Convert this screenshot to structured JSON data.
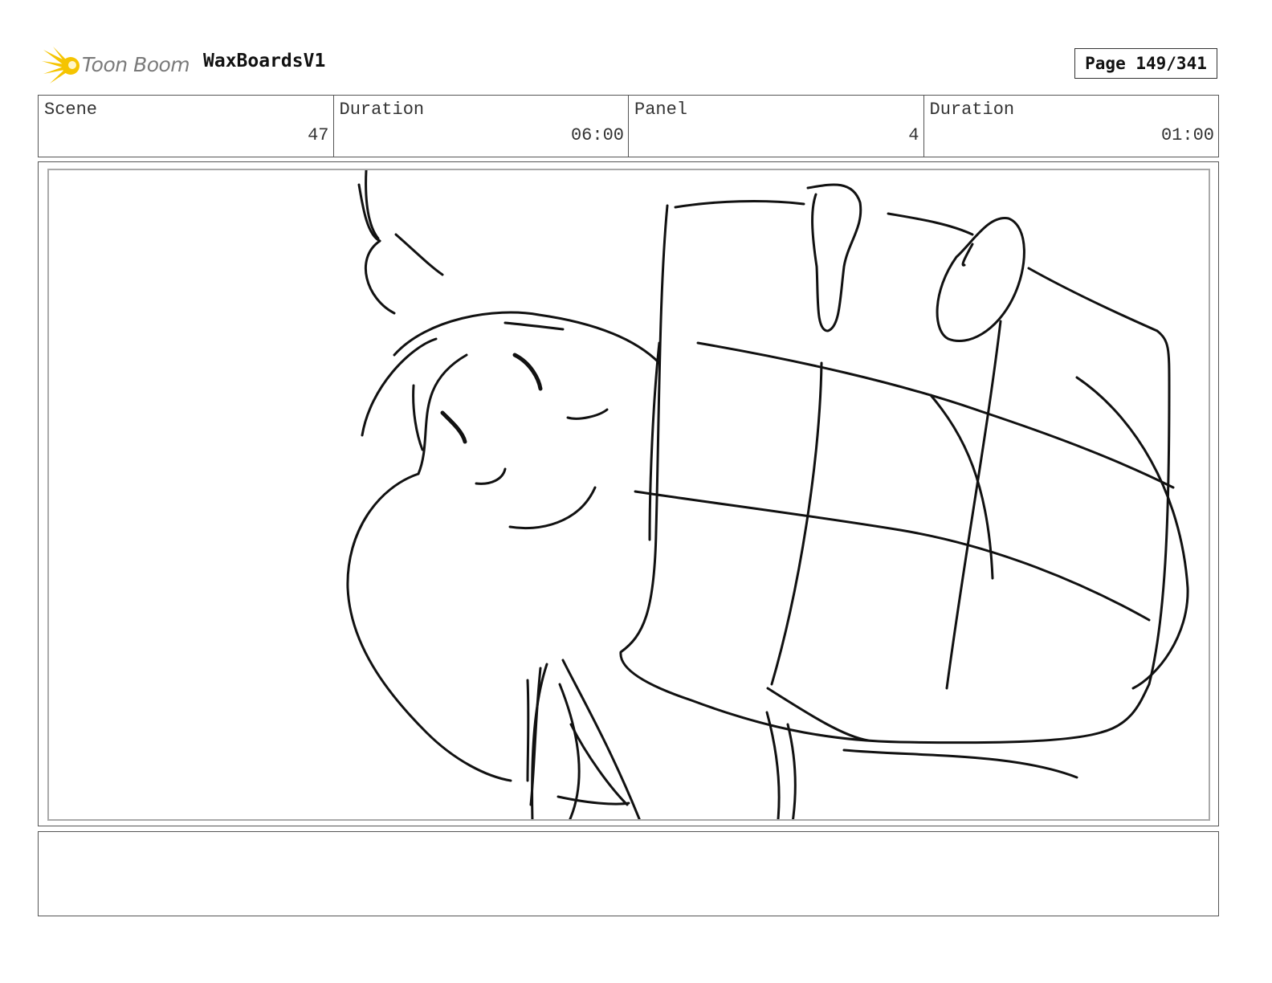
{
  "header": {
    "logo_text": "Toon Boom",
    "project_title": "WaxBoardsV1",
    "page_label": "Page 149/341"
  },
  "info": {
    "scene_label": "Scene",
    "scene_value": "47",
    "scene_duration_label": "Duration",
    "scene_duration_value": "06:00",
    "panel_label": "Panel",
    "panel_value": "4",
    "panel_duration_label": "Duration",
    "panel_duration_value": "01:00"
  },
  "panel": {
    "icon": "sketch-drawing"
  },
  "notes": {
    "text": ""
  },
  "colors": {
    "logo_accent": "#f5c400",
    "border": "#555555"
  }
}
